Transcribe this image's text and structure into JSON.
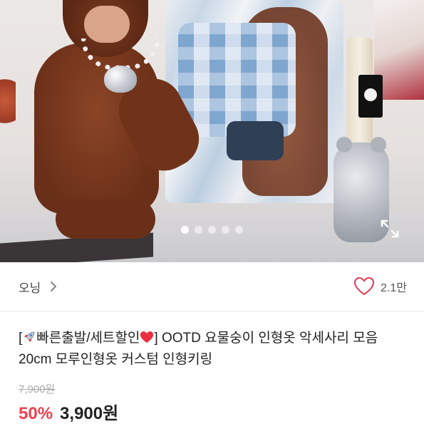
{
  "seller": {
    "name": "오닝",
    "like_count": "2.1만"
  },
  "gallery": {
    "image_count": 5,
    "active_index": 0
  },
  "product": {
    "title_open": "[",
    "title_tag": "빠른출발/세트할인",
    "title_close": "]",
    "title_main": " OOTD 요물숭이 인형옷 악세사리 모음 20cm 모루인형옷 커스텀 인형키링",
    "original_price": "7,900원",
    "discount": "50%",
    "price": "3,900원"
  },
  "colors": {
    "discount": "#f0404e",
    "like_icon": "#e23b55"
  },
  "icons": {
    "rocket": "rocket-icon",
    "heart": "heart-icon",
    "chevron": "chevron-right-icon",
    "expand": "expand-icon"
  }
}
